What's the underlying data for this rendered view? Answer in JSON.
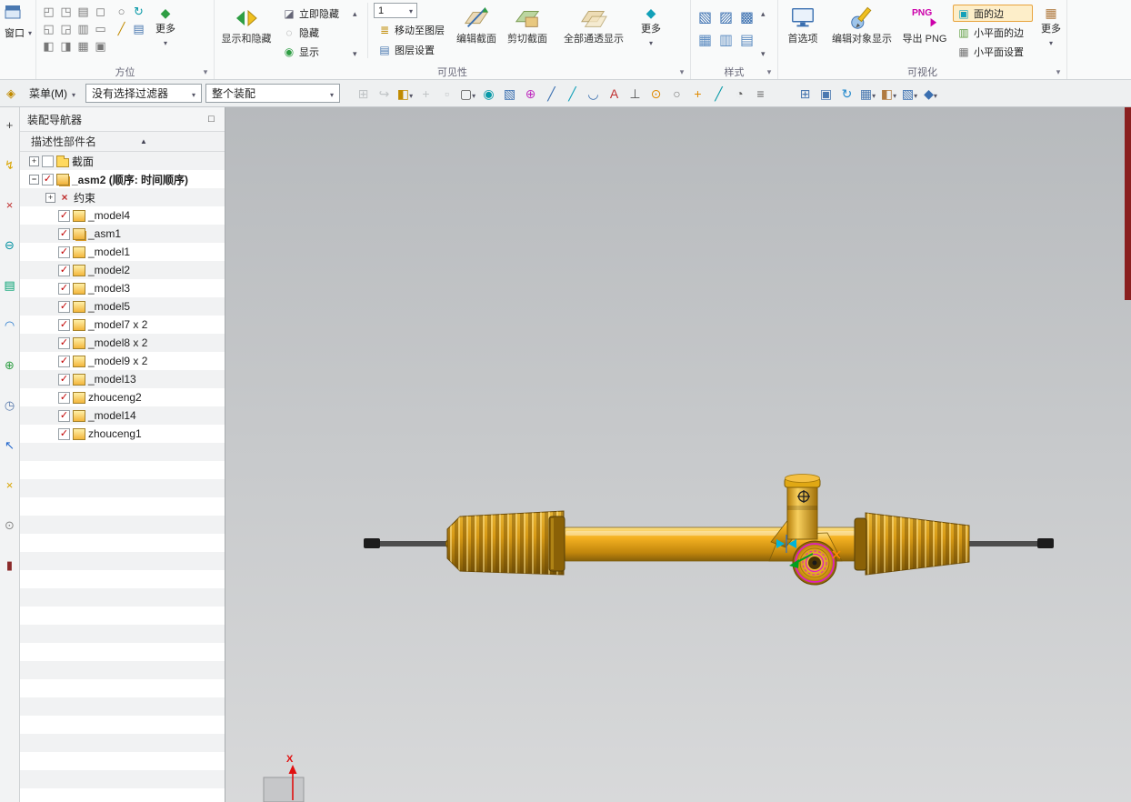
{
  "ribbon": {
    "window_label": "窗口",
    "more_label": "更多",
    "groups": {
      "orientation": "方位",
      "visibility": "可见性",
      "style": "样式",
      "visualization": "可视化"
    },
    "orientation_icons": [
      {
        "name": "view-front",
        "glyph": "◰",
        "color": "#777"
      },
      {
        "name": "view-back",
        "glyph": "◳",
        "color": "#777"
      },
      {
        "name": "view-top",
        "glyph": "▤",
        "color": "#777"
      },
      {
        "name": "view-bottom",
        "glyph": "◻",
        "color": "#777"
      },
      {
        "name": "view-left",
        "glyph": "◱",
        "color": "#777"
      },
      {
        "name": "view-right",
        "glyph": "◲",
        "color": "#777"
      },
      {
        "name": "view-isometric",
        "glyph": "▥",
        "color": "#777"
      },
      {
        "name": "view-trimetric",
        "glyph": "▭",
        "color": "#777"
      },
      {
        "name": "rotate-view",
        "glyph": "◧",
        "color": "#777"
      },
      {
        "name": "pan-view",
        "glyph": "◨",
        "color": "#777"
      },
      {
        "name": "zoom-view",
        "glyph": "▦",
        "color": "#777"
      },
      {
        "name": "fit-all",
        "glyph": "▣",
        "color": "#777"
      }
    ],
    "orientation_extra_icons": [
      {
        "name": "perspective",
        "glyph": "○",
        "color": "#777"
      },
      {
        "name": "regenerate-view",
        "glyph": "↻",
        "color": "#0a9aa8"
      },
      {
        "name": "edit-view",
        "glyph": "╱",
        "color": "#c08a00"
      },
      {
        "name": "layer-visible-in-view",
        "glyph": "▤",
        "color": "#4a78b0"
      }
    ],
    "show_hide_label": "显示和隐藏",
    "immediate_hide_label": "立即隐藏",
    "hide_label": "隐藏",
    "show_label": "显示",
    "layer_combo_value": "1",
    "move_to_layer_label": "移动至图层",
    "layer_settings_label": "图层设置",
    "edit_section_label": "编辑截面",
    "clip_section_label": "剪切截面",
    "show_through_label": "全部通透显示",
    "style_icons": [
      {
        "name": "style-shaded-with-edges",
        "glyph": "▧",
        "color": "#3a6fb0"
      },
      {
        "name": "style-shaded",
        "glyph": "▨",
        "color": "#3a6fb0"
      },
      {
        "name": "style-partially-shaded",
        "glyph": "▩",
        "color": "#3a6fb0"
      },
      {
        "name": "style-wireframe",
        "glyph": "▦",
        "color": "#5a8ac0"
      },
      {
        "name": "style-studio",
        "glyph": "▥",
        "color": "#5a8ac0"
      },
      {
        "name": "style-face-analysis",
        "glyph": "▤",
        "color": "#5a8ac0"
      }
    ],
    "preferences_label": "首选项",
    "edit_object_display_label": "编辑对象显示",
    "export_png_label": "导出 PNG",
    "png_badge": "PNG",
    "face_edges_label": "面的边",
    "facet_edges_label": "小平面的边",
    "facet_settings_label": "小平面设置"
  },
  "menubar": {
    "menu_label": "菜单(M)",
    "selection_filter_value": "没有选择过滤器",
    "selection_scope_value": "整个装配",
    "tools": [
      {
        "name": "fit-view",
        "glyph": "⊞",
        "color": "#8a8f94",
        "disabled": true
      },
      {
        "name": "pan",
        "glyph": "↪",
        "color": "#8a8f94",
        "disabled": true
      },
      {
        "name": "orient-view",
        "glyph": "◧",
        "color": "#c08a00",
        "dropdown": true
      },
      {
        "name": "move-object",
        "glyph": "+",
        "color": "#8a8f94",
        "disabled": true
      },
      {
        "name": "show-only",
        "glyph": "▫",
        "color": "#8a8f94",
        "disabled": true
      },
      {
        "name": "select-rectangle",
        "glyph": "▢",
        "color": "#555",
        "dropdown": true
      },
      {
        "name": "sphere-select",
        "glyph": "◉",
        "color": "#0a9aa8"
      },
      {
        "name": "solid-select",
        "glyph": "▧",
        "color": "#3a6fb0"
      },
      {
        "name": "snap-point",
        "glyph": "⊕",
        "color": "#c030c0"
      },
      {
        "name": "snap-endpoint",
        "glyph": "╱",
        "color": "#3a6fb0"
      },
      {
        "name": "snap-midpoint",
        "glyph": "╱",
        "color": "#12a0b8"
      },
      {
        "name": "snap-arc",
        "glyph": "◡",
        "color": "#3a6fb0"
      },
      {
        "name": "snap-text",
        "glyph": "A",
        "color": "#c03030"
      },
      {
        "name": "snap-perpendicular",
        "glyph": "⊥",
        "color": "#555"
      },
      {
        "name": "snap-center",
        "glyph": "⊙",
        "color": "#e08a00"
      },
      {
        "name": "snap-circle",
        "glyph": "○",
        "color": "#777"
      },
      {
        "name": "snap-quadrant",
        "glyph": "+",
        "color": "#e08a00"
      },
      {
        "name": "snap-tangent",
        "glyph": "╱",
        "color": "#0a9aa8"
      },
      {
        "name": "render-scene",
        "glyph": "◔",
        "color": "#666"
      },
      {
        "name": "object-list",
        "glyph": "≡",
        "color": "#666"
      },
      {
        "name": "window-tile",
        "glyph": "⊞",
        "color": "#4a78b0",
        "gap": true
      },
      {
        "name": "snapshot",
        "glyph": "▣",
        "color": "#4a78b0"
      },
      {
        "name": "refresh-view",
        "glyph": "↻",
        "color": "#2288cc"
      },
      {
        "name": "grid-display",
        "glyph": "▦",
        "color": "#4a78b0",
        "dropdown": true
      },
      {
        "name": "visual-effects",
        "glyph": "◧",
        "color": "#b07a40",
        "dropdown": true
      },
      {
        "name": "render-style",
        "glyph": "▧",
        "color": "#3a6fb0",
        "dropdown": true
      },
      {
        "name": "shaded-display",
        "glyph": "◆",
        "color": "#3a6fb0",
        "dropdown": true
      }
    ]
  },
  "sidebar": {
    "tabs": [
      {
        "name": "selection-tool-tab",
        "glyph": "+",
        "color": "#444"
      },
      {
        "name": "quick-access-tab",
        "glyph": "↯",
        "color": "#d9a400"
      },
      {
        "name": "constraint-navigator-tab",
        "glyph": "×",
        "color": "#c03030"
      },
      {
        "name": "remove-tab",
        "glyph": "⊖",
        "color": "#0090a0"
      },
      {
        "name": "part-navigator-tab",
        "glyph": "▤",
        "color": "#00a070"
      },
      {
        "name": "touch-mode-tab",
        "glyph": "◠",
        "color": "#2277cc"
      },
      {
        "name": "web-browser-tab",
        "glyph": "⊕",
        "color": "#2f9e44"
      },
      {
        "name": "history-tab",
        "glyph": "◷",
        "color": "#5577aa"
      },
      {
        "name": "process-studio-tab",
        "glyph": "↖",
        "color": "#2266cc"
      },
      {
        "name": "manage-tab",
        "glyph": "×",
        "color": "#d9a400"
      },
      {
        "name": "tools-tab",
        "glyph": "⊙",
        "color": "#888"
      },
      {
        "name": "templates-tab",
        "glyph": "▮",
        "color": "#8a2a2a"
      }
    ]
  },
  "navigator": {
    "title": "装配导航器",
    "column_header": "描述性部件名",
    "sort_glyph": "▲",
    "tree": [
      {
        "label": "截面",
        "depth": 0,
        "expand": "plus",
        "check": false,
        "icon": "folder"
      },
      {
        "label": "_asm2 (顺序: 时间顺序)",
        "depth": 0,
        "expand": "minus",
        "check": true,
        "icon": "assembly",
        "bold": true
      },
      {
        "label": "约束",
        "depth": 1,
        "expand": "plus",
        "check": null,
        "icon": "constraint"
      },
      {
        "label": "_model4",
        "depth": 1,
        "expand": null,
        "check": true,
        "icon": "part"
      },
      {
        "label": "_asm1",
        "depth": 1,
        "expand": null,
        "check": true,
        "icon": "assembly"
      },
      {
        "label": "_model1",
        "depth": 1,
        "expand": null,
        "check": true,
        "icon": "part"
      },
      {
        "label": "_model2",
        "depth": 1,
        "expand": null,
        "check": true,
        "icon": "part"
      },
      {
        "label": "_model3",
        "depth": 1,
        "expand": null,
        "check": true,
        "icon": "part"
      },
      {
        "label": "_model5",
        "depth": 1,
        "expand": null,
        "check": true,
        "icon": "part"
      },
      {
        "label": "_model7 x 2",
        "depth": 1,
        "expand": null,
        "check": true,
        "icon": "part"
      },
      {
        "label": "_model8 x 2",
        "depth": 1,
        "expand": null,
        "check": true,
        "icon": "part"
      },
      {
        "label": "_model9 x 2",
        "depth": 1,
        "expand": null,
        "check": true,
        "icon": "part"
      },
      {
        "label": "_model13",
        "depth": 1,
        "expand": null,
        "check": true,
        "icon": "part"
      },
      {
        "label": "zhouceng2",
        "depth": 1,
        "expand": null,
        "check": true,
        "icon": "part"
      },
      {
        "label": "_model14",
        "depth": 1,
        "expand": null,
        "check": true,
        "icon": "part"
      },
      {
        "label": "zhouceng1",
        "depth": 1,
        "expand": null,
        "check": true,
        "icon": "part"
      }
    ]
  },
  "viewport": {
    "axis_x_label": "X"
  },
  "icons": {
    "menu_badge": "◈",
    "float_panel": "□",
    "immediate_hide": "◪",
    "hide": "◌",
    "show": "◉",
    "move_to_layer": "≣",
    "layer_settings": "▤",
    "face_edges": "▣",
    "facet_edges": "▥",
    "facet_settings": "▦",
    "more_orientation": "◆",
    "more_visibility": "◆",
    "more_visualization": "▦",
    "check_glyph": "✓",
    "constraint_glyph": "×",
    "expand_open": "−",
    "expand_closed": "+"
  },
  "colors": {
    "model_yellow": "#e8a20c",
    "selection_magenta": "#e01fc0",
    "check_red": "#c00000",
    "edge_strip_maroon": "#8a1f1f"
  }
}
